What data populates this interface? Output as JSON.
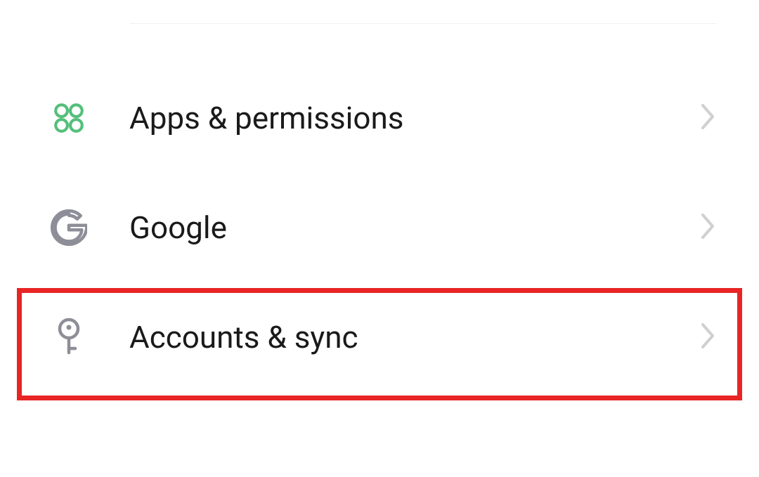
{
  "settings": {
    "items": [
      {
        "id": "apps-permissions",
        "icon": "apps-grid",
        "label": "Apps & permissions"
      },
      {
        "id": "google",
        "icon": "google-g",
        "label": "Google"
      },
      {
        "id": "accounts-sync",
        "icon": "key",
        "label": "Accounts & sync"
      }
    ]
  },
  "highlight": {
    "targetItemId": "accounts-sync",
    "color": "#e82424"
  }
}
